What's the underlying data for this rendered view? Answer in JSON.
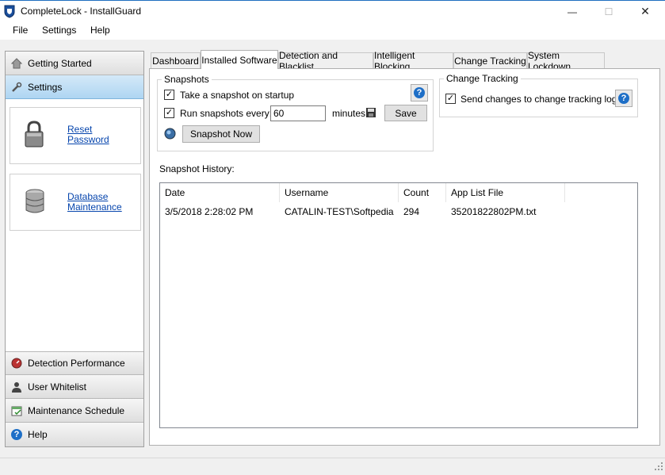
{
  "window": {
    "title": "CompleteLock - InstallGuard",
    "minimize": "—",
    "maximize": "☐",
    "close": "✕"
  },
  "menu": [
    "File",
    "Settings",
    "Help"
  ],
  "sidebar": {
    "top_items": [
      {
        "label": "Getting Started",
        "icon": "home-icon"
      },
      {
        "label": "Settings",
        "icon": "wrench-icon",
        "active": true
      }
    ],
    "cards": [
      {
        "line1": "Reset",
        "line2": "Password",
        "icon": "lock-icon"
      },
      {
        "line1": "Database",
        "line2": "Maintenance",
        "icon": "database-icon"
      }
    ],
    "bottom_items": [
      {
        "label": "Detection Performance",
        "icon": "gauge-icon"
      },
      {
        "label": "User Whitelist",
        "icon": "user-icon"
      },
      {
        "label": "Maintenance Schedule",
        "icon": "schedule-icon"
      },
      {
        "label": "Help",
        "icon": "help-icon"
      }
    ]
  },
  "tabs": [
    {
      "label": "Dashboard"
    },
    {
      "label": "Installed Software",
      "active": true
    },
    {
      "label": "Detection and Blacklist"
    },
    {
      "label": "Intelligent Blocking"
    },
    {
      "label": "Change Tracking"
    },
    {
      "label": "System Lockdown"
    }
  ],
  "snapshots": {
    "legend": "Snapshots",
    "startup_label": "Take a snapshot on startup",
    "startup_checked": true,
    "run_every_label": "Run snapshots every:",
    "run_every_checked": true,
    "interval_value": "60",
    "minutes_label": "minutes",
    "save_label": "Save",
    "snapshot_now_label": "Snapshot Now"
  },
  "change_tracking": {
    "legend": "Change Tracking",
    "send_label": "Send changes to change tracking log",
    "send_checked": true
  },
  "history": {
    "label": "Snapshot History:",
    "columns": [
      "Date",
      "Username",
      "Count",
      "App List File"
    ],
    "rows": [
      [
        "3/5/2018 2:28:02 PM",
        "CATALIN-TEST\\Softpedia",
        "294",
        "35201822802PM.txt"
      ]
    ]
  },
  "colors": {
    "accent": "#1e6fc7",
    "link": "#0645ad",
    "active_nav": "#aed5f2"
  }
}
